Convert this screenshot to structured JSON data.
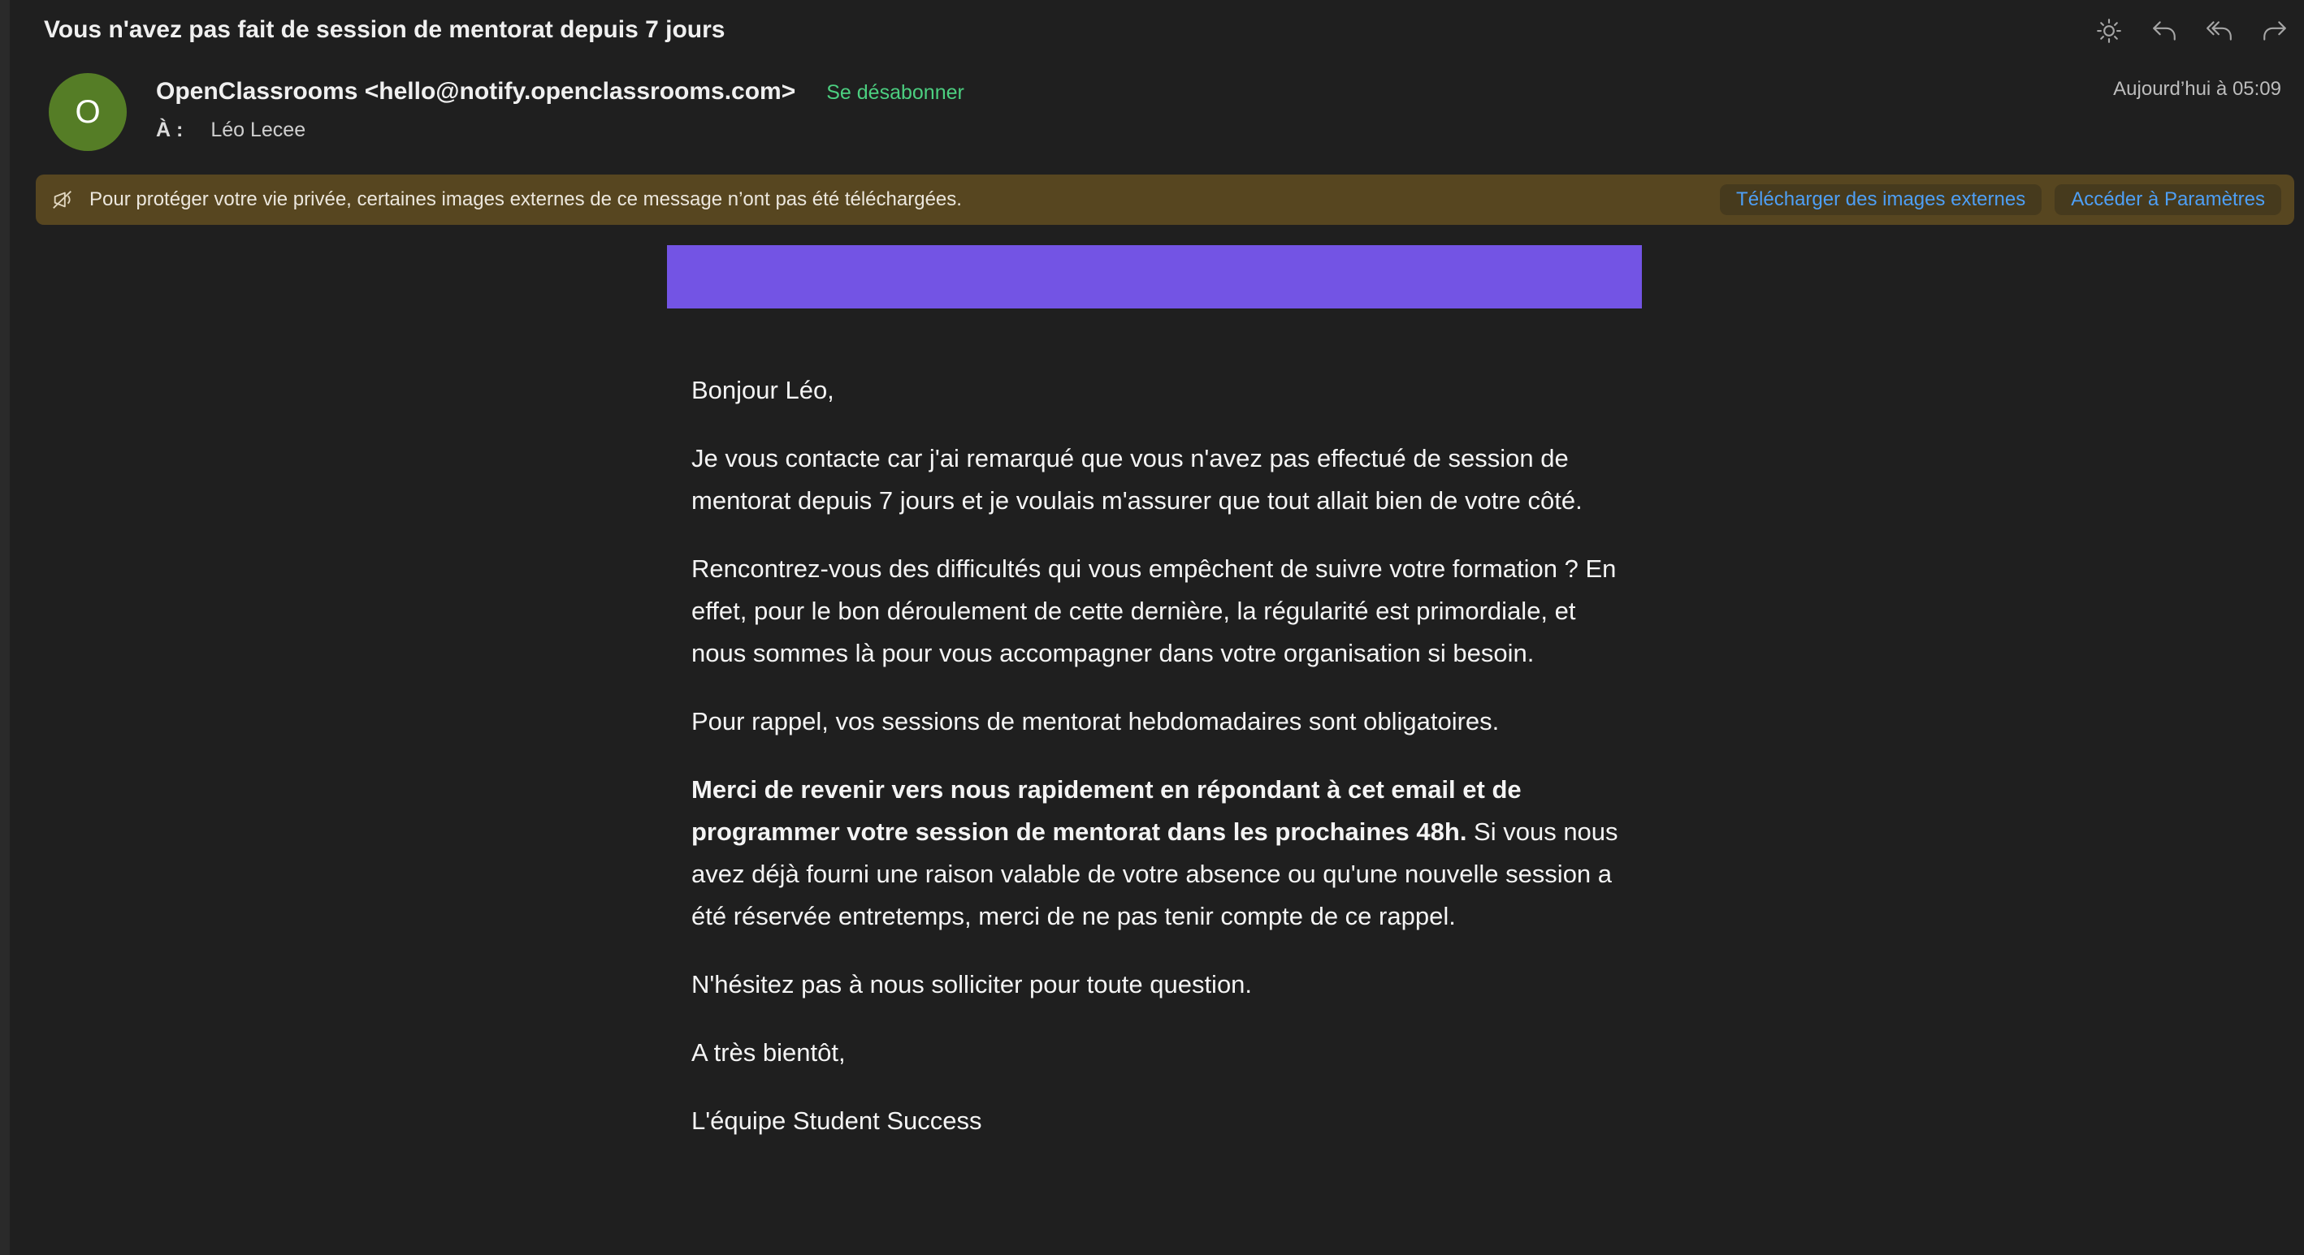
{
  "header": {
    "subject": "Vous n'avez pas fait de session de mentorat depuis 7 jours",
    "sender": "OpenClassrooms <hello@notify.openclassrooms.com>",
    "unsubscribe_label": "Se désabonner",
    "to_label": "À :",
    "to_value": "Léo Lecee",
    "date": "Aujourd’hui à 05:09",
    "avatar_initial": "O",
    "avatar_color": "#557d26"
  },
  "toolbar": {
    "icons": [
      "brightness-icon",
      "reply-icon",
      "reply-all-icon",
      "forward-icon"
    ]
  },
  "privacy_banner": {
    "text": "Pour protéger votre vie privée, certaines images externes de ce message n’ont pas été téléchargées.",
    "download_label": "Télécharger des images externes",
    "settings_label": "Accéder à Paramètres",
    "background_color": "#574620",
    "link_color": "#4e9ff5"
  },
  "email": {
    "header_bar_color": "#7354e4",
    "greeting": "Bonjour Léo,",
    "paragraph1": "Je vous contacte car j'ai remarqué que vous n'avez pas effectué de session de mentorat depuis 7 jours et je voulais m'assurer que tout allait bien de votre côté.",
    "paragraph2": "Rencontrez-vous des difficultés qui vous empêchent de suivre votre formation ? En effet, pour le bon déroulement de cette dernière, la régularité est primordiale, et nous sommes là pour vous accompagner dans votre organisation si besoin.",
    "paragraph3": "Pour rappel, vos sessions de mentorat hebdomadaires sont obligatoires.",
    "paragraph4_bold": "Merci de revenir vers nous rapidement en répondant à cet email et de programmer votre session de mentorat dans les prochaines 48h.",
    "paragraph4_rest": " Si vous nous avez déjà fourni une raison valable de votre absence ou qu'une nouvelle session a été réservée entretemps, merci de ne pas tenir compte de ce rappel.",
    "paragraph5": "N'hésitez pas à nous solliciter pour toute question.",
    "closing": "A très bientôt,",
    "signature": "L'équipe Student Success"
  }
}
